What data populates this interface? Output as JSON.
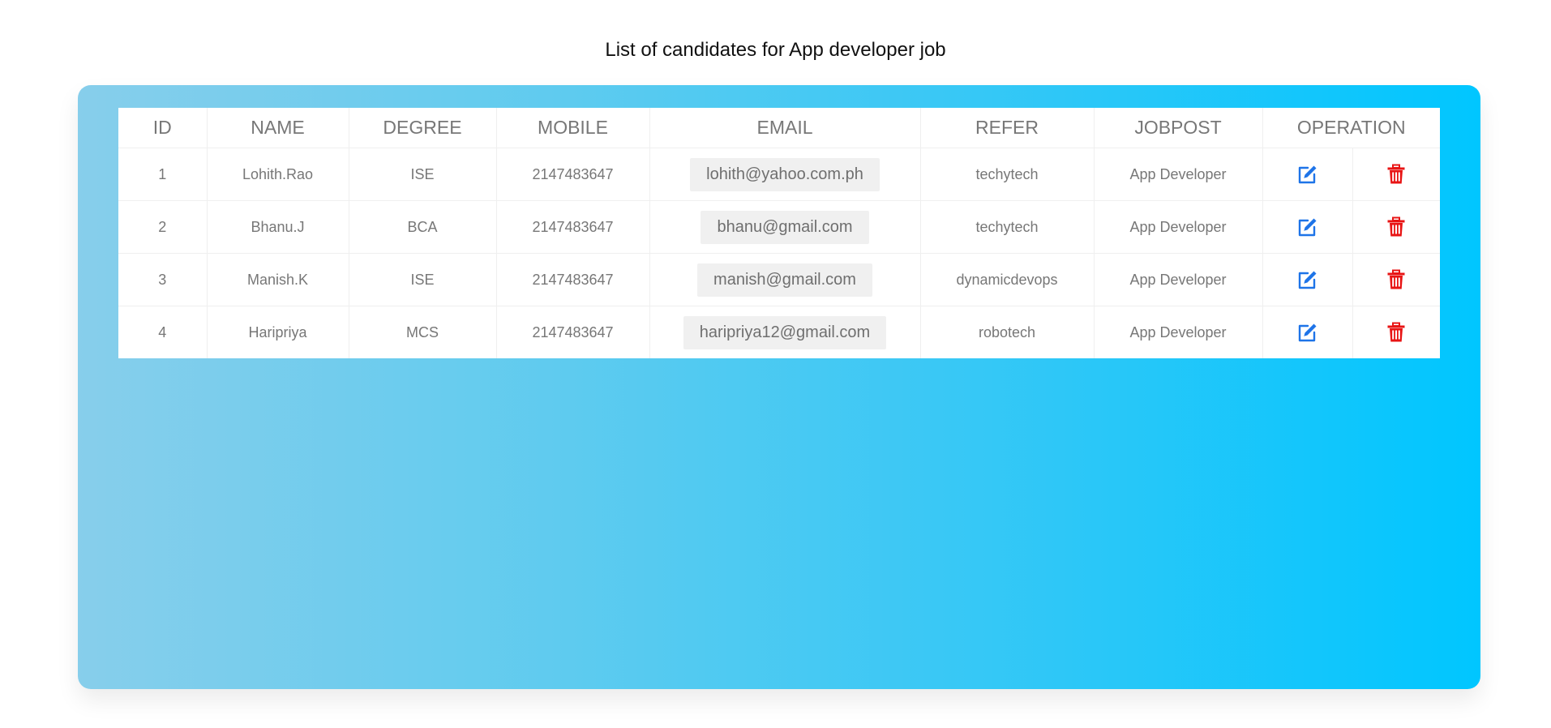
{
  "page": {
    "title": "List of candidates for App developer job"
  },
  "table": {
    "headers": {
      "id": "ID",
      "name": "NAME",
      "degree": "DEGREE",
      "mobile": "MOBILE",
      "email": "EMAIL",
      "refer": "REFER",
      "jobpost": "JOBPOST",
      "operation": "OPERATION"
    },
    "rows": [
      {
        "id": "1",
        "name": "Lohith.Rao",
        "degree": "ISE",
        "mobile": "2147483647",
        "email": "lohith@yahoo.com.ph",
        "refer": "techytech",
        "jobpost": "App Developer"
      },
      {
        "id": "2",
        "name": "Bhanu.J",
        "degree": "BCA",
        "mobile": "2147483647",
        "email": "bhanu@gmail.com",
        "refer": "techytech",
        "jobpost": "App Developer"
      },
      {
        "id": "3",
        "name": "Manish.K",
        "degree": "ISE",
        "mobile": "2147483647",
        "email": "manish@gmail.com",
        "refer": "dynamicdevops",
        "jobpost": "App Developer"
      },
      {
        "id": "4",
        "name": "Haripriya",
        "degree": "MCS",
        "mobile": "2147483647",
        "email": "haripriya12@gmail.com",
        "refer": "robotech",
        "jobpost": "App Developer"
      }
    ],
    "operations": {
      "edit_icon": "edit-icon",
      "delete_icon": "trash-icon"
    }
  },
  "colors": {
    "edit_icon": "#1e74e8",
    "delete_icon": "#e81414",
    "panel_gradient_start": "#87ceeb",
    "panel_gradient_end": "#00c6ff"
  }
}
